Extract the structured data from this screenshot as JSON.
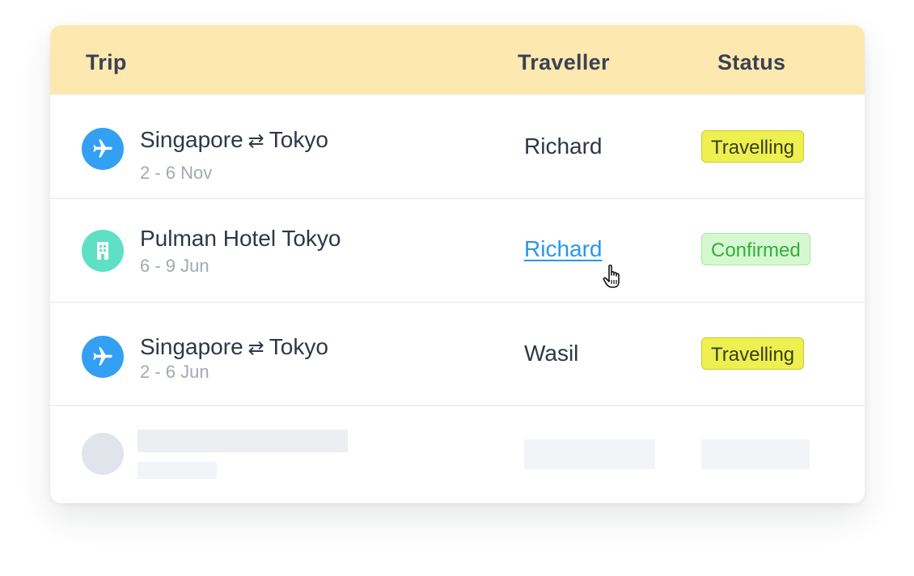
{
  "colors": {
    "header_bg": "#fde9b0",
    "flight_icon": "#33a0f4",
    "hotel_icon": "#5ee0c5",
    "link": "#2a97e6",
    "travelling_badge": "#eef050",
    "confirmed_badge": "#d6f8d0"
  },
  "header": {
    "trip": "Trip",
    "traveller": "Traveller",
    "status": "Status"
  },
  "rows": [
    {
      "icon": "airplane-icon",
      "origin": "Singapore",
      "arrow": "⇄",
      "destination": "Tokyo",
      "dates": "2 - 6 Nov",
      "traveller": "Richard",
      "status": "Travelling"
    },
    {
      "icon": "hotel-building-icon",
      "title": "Pulman Hotel Tokyo",
      "dates": "6 - 9 Jun",
      "traveller": "Richard",
      "status": "Confirmed"
    },
    {
      "icon": "airplane-icon",
      "origin": "Singapore",
      "arrow": "⇄",
      "destination": "Tokyo",
      "dates": "2 - 6 Jun",
      "traveller": "Wasil",
      "status": "Travelling"
    }
  ],
  "cursor_icon": "pointing-hand-cursor-icon"
}
